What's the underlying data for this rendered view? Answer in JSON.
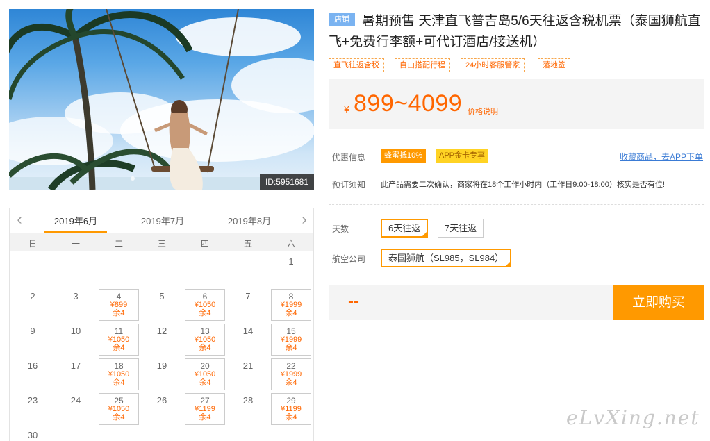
{
  "hero": {
    "id_badge": "ID:5951681"
  },
  "calendar": {
    "prev_icon": "‹",
    "next_icon": "›",
    "months": [
      "2019年6月",
      "2019年7月",
      "2019年8月"
    ],
    "weekdays": [
      "日",
      "一",
      "二",
      "三",
      "四",
      "五",
      "六"
    ],
    "days": [
      {
        "day": "1"
      },
      {
        "day": "2"
      },
      {
        "day": "3"
      },
      {
        "day": "4",
        "price": "¥899",
        "remain": "余4"
      },
      {
        "day": "5"
      },
      {
        "day": "6",
        "price": "¥1050",
        "remain": "余4"
      },
      {
        "day": "7"
      },
      {
        "day": "8",
        "price": "¥1999",
        "remain": "余4"
      },
      {
        "day": "9"
      },
      {
        "day": "10"
      },
      {
        "day": "11",
        "price": "¥1050",
        "remain": "余4"
      },
      {
        "day": "12"
      },
      {
        "day": "13",
        "price": "¥1050",
        "remain": "余4"
      },
      {
        "day": "14"
      },
      {
        "day": "15",
        "price": "¥1999",
        "remain": "余4"
      },
      {
        "day": "16"
      },
      {
        "day": "17"
      },
      {
        "day": "18",
        "price": "¥1050",
        "remain": "余4"
      },
      {
        "day": "19"
      },
      {
        "day": "20",
        "price": "¥1050",
        "remain": "余4"
      },
      {
        "day": "21"
      },
      {
        "day": "22",
        "price": "¥1999",
        "remain": "余4"
      },
      {
        "day": "23"
      },
      {
        "day": "24"
      },
      {
        "day": "25",
        "price": "¥1050",
        "remain": "余4"
      },
      {
        "day": "26"
      },
      {
        "day": "27",
        "price": "¥1199",
        "remain": "余4"
      },
      {
        "day": "28"
      },
      {
        "day": "29",
        "price": "¥1199",
        "remain": "余4"
      },
      {
        "day": "30"
      }
    ]
  },
  "product": {
    "shop_tag": "店铺",
    "title": "暑期预售 天津直飞普吉岛5/6天往返含税机票（泰国狮航直飞+免费行李额+可代订酒店/接送机）",
    "tags": [
      "直飞往返含税",
      "自由搭配行程",
      "24小时客服管家",
      "落地签"
    ],
    "price_yen": "¥",
    "price_range": "899~4099",
    "price_note": "价格说明",
    "promo_label": "优惠信息",
    "promo_1": "蜂蜜抵10%",
    "promo_2": "APP金卡专享",
    "favorite_link": "收藏商品，去APP下单",
    "notice_label": "预订须知",
    "notice_text": "此产品需要二次确认，商家将在18个工作小时内（工作日9:00-18:00）核实是否有位!",
    "days_label": "天数",
    "days_options": [
      "6天往返",
      "7天往返"
    ],
    "airline_label": "航空公司",
    "airline_option": "泰国狮航（SL985，SL984）",
    "selected_price": "--",
    "buy_button": "立即购买"
  },
  "watermark": "eLvXing.net",
  "colors": {
    "accent": "#ff9900",
    "price": "#ff6600",
    "shop_tag": "#7ab3f1",
    "link": "#3a7bd5"
  }
}
